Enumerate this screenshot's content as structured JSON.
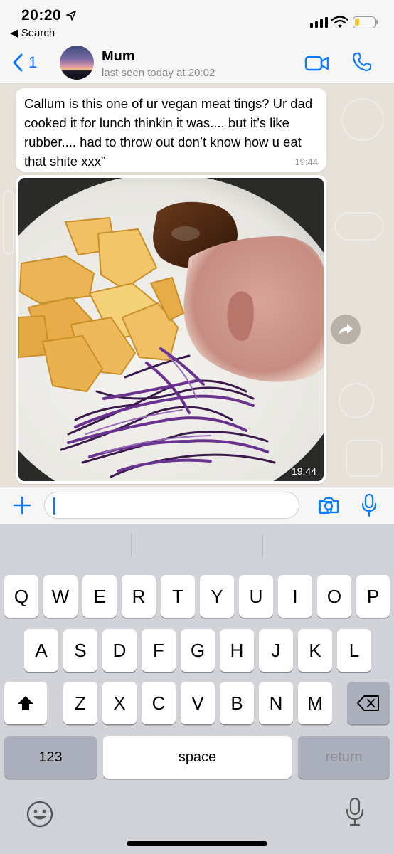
{
  "status": {
    "time": "20:20",
    "back_app": "◀ Search"
  },
  "header": {
    "back_count": "1",
    "contact_name": "Mum",
    "contact_status": "last seen today at 20:02"
  },
  "messages": [
    {
      "type": "text",
      "text": "Callum is this one of ur vegan meat tings? Ur dad cooked it for lunch thinkin it was.... but it’s like rubber.... had to throw out don’t know how u eat that shite xxx”",
      "time": "19:44"
    },
    {
      "type": "image",
      "icon": "food-photo",
      "time": "19:44"
    }
  ],
  "input": {
    "value": "",
    "placeholder": ""
  },
  "keyboard": {
    "row1": [
      "Q",
      "W",
      "E",
      "R",
      "T",
      "Y",
      "U",
      "I",
      "O",
      "P"
    ],
    "row2": [
      "A",
      "S",
      "D",
      "F",
      "G",
      "H",
      "J",
      "K",
      "L"
    ],
    "row3": [
      "Z",
      "X",
      "C",
      "V",
      "B",
      "N",
      "M"
    ],
    "numbers_label": "123",
    "space_label": "space",
    "return_label": "return"
  },
  "colors": {
    "accent": "#0a7cff",
    "chat_bg": "#e6e1d9",
    "keyboard_bg": "#d1d3d9"
  }
}
